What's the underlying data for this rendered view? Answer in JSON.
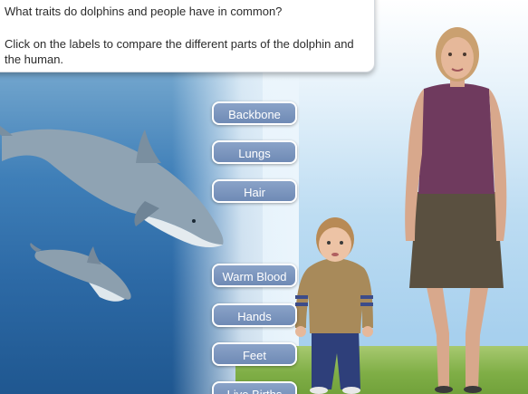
{
  "prompt": {
    "question": "What traits do dolphins and people have in common?",
    "instructions": "Click on the labels to compare the different parts of the dolphin and the human."
  },
  "labels": [
    "Backbone",
    "Lungs",
    "Hair",
    "Warm Blood",
    "Hands",
    "Feet",
    "Live Births"
  ],
  "colors": {
    "button_fill": "#7590bb",
    "woman_top": "#6f3a5e",
    "woman_skirt": "#5a5040",
    "child_sweater": "#a88a5a",
    "child_pants": "#2e3f7a"
  }
}
